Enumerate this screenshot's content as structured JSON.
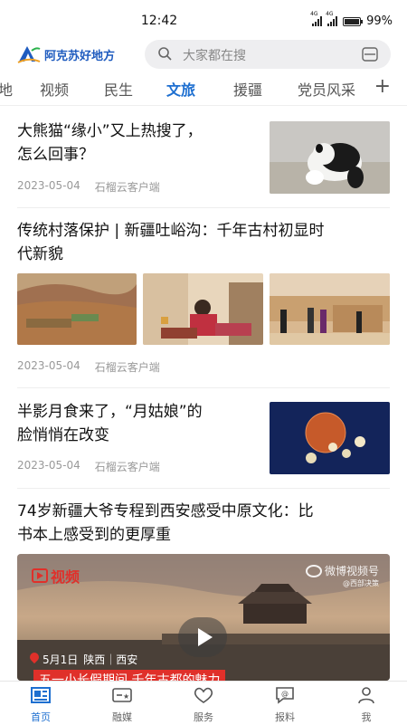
{
  "status": {
    "time": "12:42",
    "battery": "99%",
    "net1": "4G",
    "net2": "4G",
    "battery_level": 0.99
  },
  "header": {
    "logo_text": "阿克苏好地方",
    "search_placeholder": "大家都在搜"
  },
  "tabs": {
    "items": [
      "地",
      "视频",
      "民生",
      "文旅",
      "援疆",
      "党员风采"
    ],
    "active": "文旅"
  },
  "articles": [
    {
      "title_l1": "大熊猫“缘小”又上热搜了，",
      "title_l2": "怎么回事？",
      "date": "2023-05-04",
      "source": "石榴云客户端"
    },
    {
      "title_l1": "传统村落保护 | 新疆吐峪沟：千年古村初显时",
      "title_l2": "代新貌",
      "date": "2023-05-04",
      "source": "石榴云客户端"
    },
    {
      "title_l1": "半影月食来了，“月姑娘”的",
      "title_l2": "脸悄悄在改变",
      "date": "2023-05-04",
      "source": "石榴云客户端"
    },
    {
      "title_l1": "74岁新疆大爷专程到西安感受中原文化：比",
      "title_l2": "书本上感受到的更厚重"
    }
  ],
  "video": {
    "badge": "视频",
    "watermark": "微博视频号",
    "watermark_sub": "@西部决策",
    "caption_date": "5月1日",
    "caption_place": "陕西｜西安",
    "caption_title": "五一小长假期间 千年古都的魅力"
  },
  "bottomnav": {
    "items": [
      "首页",
      "融媒",
      "服务",
      "报料",
      "我"
    ],
    "active": "首页"
  },
  "colors": {
    "accent": "#1e6fd0",
    "logo_blue": "#1e5bbf",
    "muted": "#999999"
  }
}
